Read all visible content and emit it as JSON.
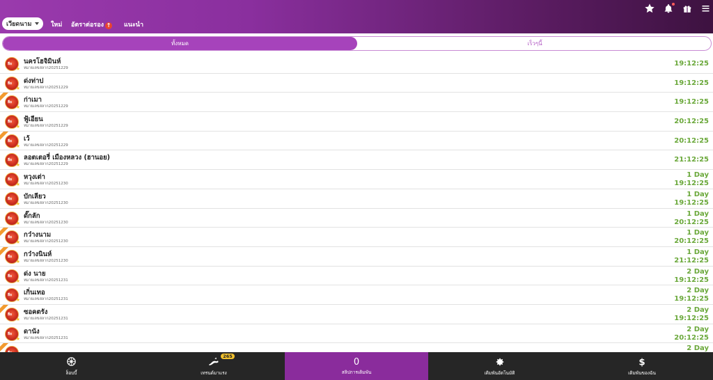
{
  "header": {
    "dropdown_label": "เวียดนาม",
    "nav": [
      "ใหม่",
      "อัตราต่อรอง",
      "แนะนำ"
    ],
    "nav_up_badge": "↑",
    "icons": [
      "star-icon",
      "bell-icon",
      "gift-icon",
      "menu-icon"
    ]
  },
  "tabs": {
    "all": "ทั้งหมด",
    "fast": "เร็วๆนี้"
  },
  "logo_text": "ฮือ",
  "rows": [
    {
      "name": "นครโฮจิมินห์",
      "code": "หมายเลขสลาก20251229",
      "day": "",
      "time": "19:12:25",
      "ribbon": false
    },
    {
      "name": "ด่งท่าป",
      "code": "หมายเลขสลาก20251229",
      "day": "",
      "time": "19:12:25",
      "ribbon": false
    },
    {
      "name": "ก่าเมา",
      "code": "หมายเลขสลาก20251229",
      "day": "",
      "time": "19:12:25",
      "ribbon": true
    },
    {
      "name": "ฟู้เอียน",
      "code": "หมายเลขสลาก20251229",
      "day": "",
      "time": "20:12:25",
      "ribbon": false
    },
    {
      "name": "เว้",
      "code": "หมายเลขสลาก20251229",
      "day": "",
      "time": "20:12:25",
      "ribbon": true
    },
    {
      "name": "ลอตเตอรี่ เมืองหลวง (ฮานอย)",
      "code": "หมายเลขสลาก20251229",
      "day": "",
      "time": "21:12:25",
      "ribbon": false
    },
    {
      "name": "หวุงเต่า",
      "code": "หมายเลขสลาก20251230",
      "day": "1 Day",
      "time": "19:12:25",
      "ribbon": false
    },
    {
      "name": "บักเลียว",
      "code": "หมายเลขสลาก20251230",
      "day": "1 Day",
      "time": "19:12:25",
      "ribbon": false
    },
    {
      "name": "ดั๊กลัก",
      "code": "หมายเลขสลาก20251230",
      "day": "1 Day",
      "time": "20:12:25",
      "ribbon": false
    },
    {
      "name": "กว๋างนาม",
      "code": "หมายเลขสลาก20251230",
      "day": "1 Day",
      "time": "20:12:25",
      "ribbon": true
    },
    {
      "name": "กว๋างนินห์",
      "code": "หมายเลขสลาก20251230",
      "day": "1 Day",
      "time": "21:12:25",
      "ribbon": true
    },
    {
      "name": "ด่ง นาย",
      "code": "หมายเลขสลาก20251231",
      "day": "2 Day",
      "time": "19:12:25",
      "ribbon": false
    },
    {
      "name": "เกิ่นเทอ",
      "code": "หมายเลขสลาก20251231",
      "day": "2 Day",
      "time": "19:12:25",
      "ribbon": false
    },
    {
      "name": "ซอคตรัง",
      "code": "หมายเลขสลาก20251231",
      "day": "2 Day",
      "time": "19:12:25",
      "ribbon": true
    },
    {
      "name": "ดานัง",
      "code": "หมายเลขสลาก20251231",
      "day": "2 Day",
      "time": "20:12:25",
      "ribbon": false
    },
    {
      "name": "",
      "code": "",
      "day": "2 Day",
      "time": "",
      "ribbon": true
    }
  ],
  "bottom": {
    "lobby": "ล็อบบี้",
    "trends": "เทรนด์มาแรง",
    "trends_badge": "265",
    "bet_count": "0",
    "bet_list": "สลิปการเดิมพัน",
    "my_bets": "เดิมพันอัตโนมัติ",
    "my_wallet": "เดิมพันของฉัน"
  },
  "colors": {
    "accent": "#a643bb",
    "time_green": "#6aa83a",
    "bottom_bg": "#262626"
  }
}
